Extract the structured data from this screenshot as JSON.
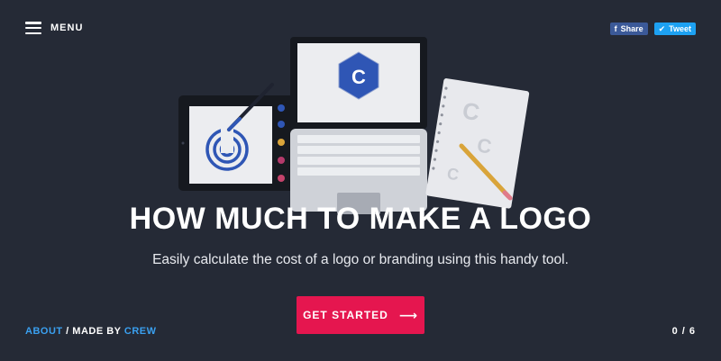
{
  "header": {
    "menu_label": "MENU",
    "share_label": "Share",
    "tweet_label": "Tweet"
  },
  "hero": {
    "title": "HOW MUCH TO MAKE A LOGO",
    "subtitle": "Easily calculate the cost of a logo or branding using this handy tool.",
    "cta_label": "GET STARTED",
    "screen_letter": "C"
  },
  "footer": {
    "about_label": "ABOUT",
    "separator": "/",
    "made_by_label": "MADE BY",
    "crew_label": "CREW",
    "progress": "0 / 6"
  },
  "colors": {
    "background": "#252a36",
    "cta": "#e5164f",
    "link": "#3aa0f0",
    "facebook": "#3b5998",
    "twitter": "#1da1f2",
    "logo_blue": "#2f56b5"
  },
  "icons": [
    "hamburger-icon",
    "facebook-icon",
    "twitter-icon",
    "arrow-right-icon"
  ]
}
